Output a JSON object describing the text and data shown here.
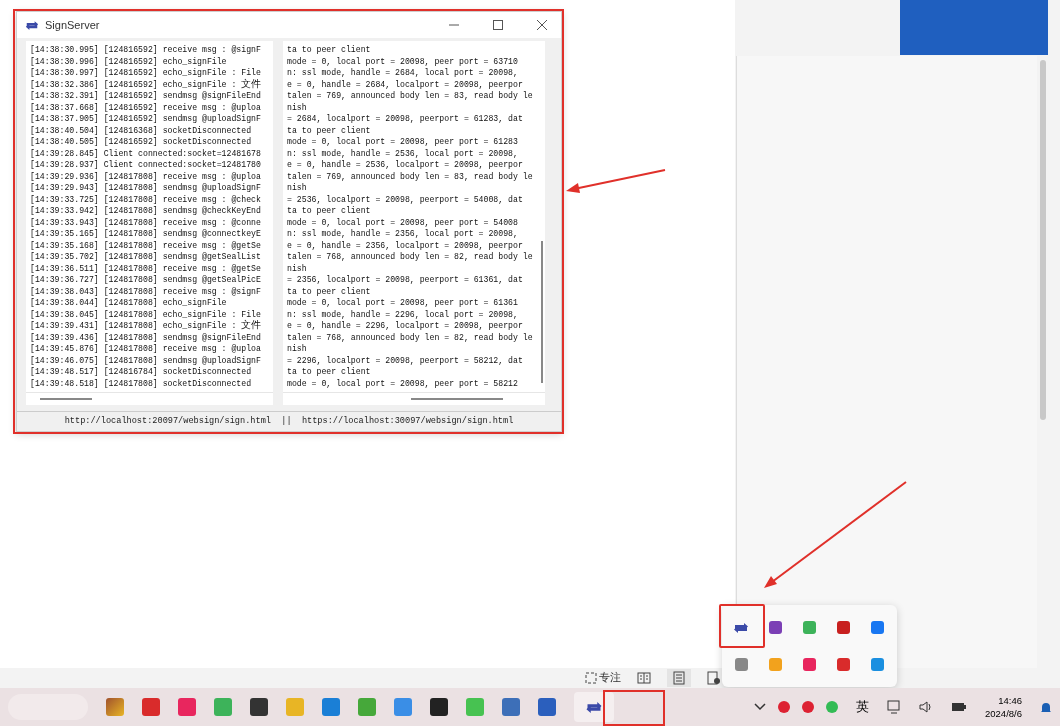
{
  "window": {
    "title": "SignServer",
    "log_left": [
      "[14:38:30.995] [124816592] receive msg : @signF",
      "[14:38:30.996] [124816592] echo_signFile",
      "[14:38:30.997] [124816592] echo_signFile : File",
      "[14:38:32.386] [124816592] echo_signFile : 文件",
      "[14:38:32.391] [124816592] sendmsg @signFileEnd",
      "[14:38:37.668] [124816592] receive msg : @uploa",
      "[14:38:37.905] [124816592] sendmsg @uploadSignF",
      "[14:38:40.504] [124816368] socketDisconnected",
      "[14:38:40.505] [124816592] socketDisconnected",
      "[14:39:28.845] Client connected:socket=12481678",
      "[14:39:28.937] Client connected:socket=12481780",
      "[14:39:29.936] [124817808] receive msg : @uploa",
      "[14:39:29.943] [124817808] sendmsg @uploadSignF",
      "[14:39:33.725] [124817808] receive msg : @check",
      "[14:39:33.942] [124817808] sendmsg @checkKeyEnd",
      "[14:39:33.943] [124817808] receive msg : @conne",
      "[14:39:35.165] [124817808] sendmsg @connectkeyE",
      "[14:39:35.168] [124817808] receive msg : @getSe",
      "[14:39:35.702] [124817808] sendmsg @getSealList",
      "[14:39:36.511] [124817808] receive msg : @getSe",
      "[14:39:36.727] [124817808] sendmsg @getSealPicE",
      "[14:39:38.043] [124817808] receive msg : @signF",
      "[14:39:38.044] [124817808] echo_signFile",
      "[14:39:38.045] [124817808] echo_signFile : File",
      "[14:39:39.431] [124817808] echo_signFile : 文件",
      "[14:39:39.436] [124817808] sendmsg @signFileEnd",
      "[14:39:45.876] [124817808] receive msg : @uploa",
      "[14:39:46.075] [124817808] sendmsg @uploadSignF",
      "[14:39:48.517] [124816784] socketDisconnected",
      "[14:39:48.518] [124817808] socketDisconnected"
    ],
    "log_right": [
      "ta to peer client",
      "mode = 0, local port = 20098, peer port = 63710",
      "n: ssl mode, handle = 2684, local port = 20098,",
      "e = 0, handle = 2684, localport = 20098, peerpor",
      "talen = 769, announced body len = 83, read body le",
      "nish",
      "= 2684, localport = 20098, peerport = 61283, dat",
      "ta to peer client",
      "mode = 0, local port = 20098, peer port = 61283",
      "n: ssl mode, handle = 2536, local port = 20098,",
      "e = 0, handle = 2536, localport = 20098, peerpor",
      "talen = 769, announced body len = 83, read body le",
      "nish",
      "= 2536, localport = 20098, peerport = 54008, dat",
      "ta to peer client",
      "mode = 0, local port = 20098, peer port = 54008",
      "n: ssl mode, handle = 2356, local port = 20098,",
      "e = 0, handle = 2356, localport = 20098, peerpor",
      "talen = 768, announced body len = 82, read body le",
      "nish",
      "= 2356, localport = 20098, peerport = 61361, dat",
      "ta to peer client",
      "mode = 0, local port = 20098, peer port = 61361",
      "n: ssl mode, handle = 2296, local port = 20098,",
      "e = 0, handle = 2296, localport = 20098, peerpor",
      "talen = 768, announced body len = 82, read body le",
      "nish",
      "= 2296, localport = 20098, peerport = 58212, dat",
      "ta to peer client",
      "mode = 0, local port = 20098, peer port = 58212"
    ],
    "url_bar": "http://localhost:20097/websign/sign.html  ||  https://localhost:30097/websign/sign.html"
  },
  "status_bar": {
    "focus_label": "专注"
  },
  "taskbar": {
    "input_language": "英",
    "time": "14:46",
    "date": "2024/8/6"
  }
}
